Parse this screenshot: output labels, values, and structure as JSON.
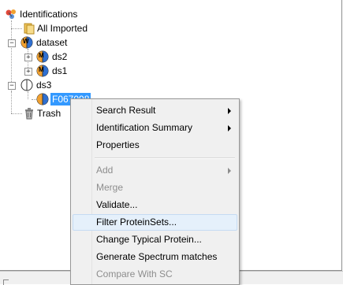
{
  "tree": {
    "root_label": "Identifications",
    "all_imported_label": "All Imported",
    "dataset_label": "dataset",
    "ds2_label": "ds2",
    "ds1_label": "ds1",
    "ds3_label": "ds3",
    "selected_label": "F067098",
    "trash_label": "Trash",
    "expand_symbol": "+",
    "collapse_symbol": "−",
    "badge_w": "W",
    "badge_m": "M"
  },
  "context_menu": {
    "items": [
      {
        "label": "Search Result",
        "submenu": true,
        "enabled": true
      },
      {
        "label": "Identification Summary",
        "submenu": true,
        "enabled": true
      },
      {
        "label": "Properties",
        "submenu": false,
        "enabled": true
      },
      {
        "label": "Add",
        "submenu": true,
        "enabled": false
      },
      {
        "label": "Merge",
        "submenu": false,
        "enabled": false
      },
      {
        "label": "Validate...",
        "submenu": false,
        "enabled": true
      },
      {
        "label": "Filter ProteinSets...",
        "submenu": false,
        "enabled": true,
        "highlighted": true
      },
      {
        "label": "Change Typical Protein...",
        "submenu": false,
        "enabled": true
      },
      {
        "label": "Generate Spectrum matches",
        "submenu": false,
        "enabled": true
      },
      {
        "label": "Compare With SC",
        "submenu": false,
        "enabled": false
      }
    ]
  },
  "colors": {
    "selection": "#3399ff",
    "icon_orange": "#f0a030",
    "icon_blue": "#2f6fd0",
    "folder_yellow": "#f2c75c"
  }
}
